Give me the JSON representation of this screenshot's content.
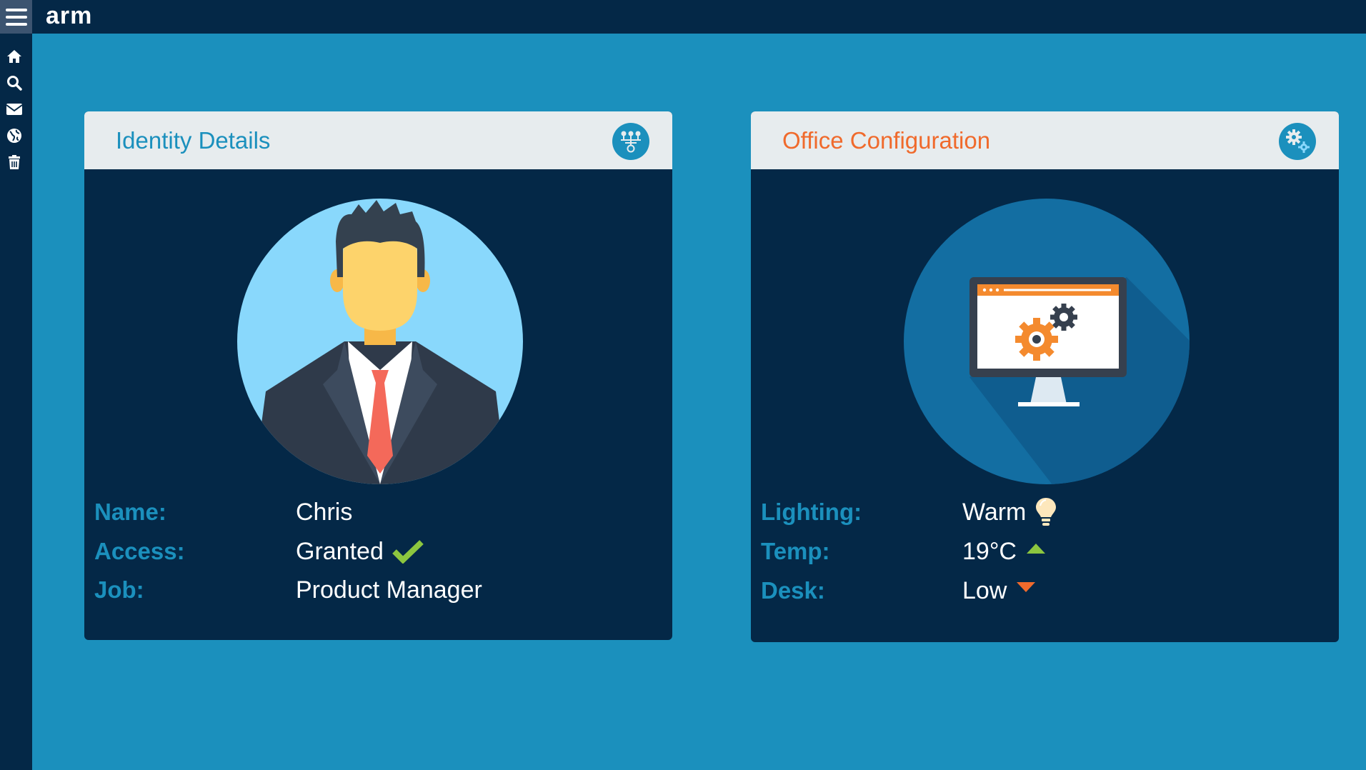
{
  "app": {
    "logo": "arm"
  },
  "sidebar": {
    "items": [
      {
        "icon": "home-icon"
      },
      {
        "icon": "search-icon"
      },
      {
        "icon": "mail-icon"
      },
      {
        "icon": "globe-icon"
      },
      {
        "icon": "trash-icon"
      }
    ]
  },
  "identity": {
    "title": "Identity Details",
    "header_icon": "network-icon",
    "fields": [
      {
        "label": "Name:",
        "value": "Chris"
      },
      {
        "label": "Access:",
        "value": "Granted",
        "icon": "check-icon"
      },
      {
        "label": "Job:",
        "value": "Product Manager"
      }
    ]
  },
  "office": {
    "title": "Office Configuration",
    "header_icon": "gears-icon",
    "fields": [
      {
        "label": "Lighting:",
        "value": "Warm",
        "icon": "lightbulb-icon"
      },
      {
        "label": "Temp:",
        "value": "19°C",
        "icon": "arrow-up-icon"
      },
      {
        "label": "Desk:",
        "value": "Low",
        "icon": "arrow-down-icon"
      }
    ]
  },
  "colors": {
    "background": "#1b90bd",
    "dark": "#042847",
    "header_bg": "#e7ecee",
    "accent_blue": "#1b90bd",
    "accent_orange": "#f06a2c",
    "check_green": "#8cc63f",
    "arrow_up_green": "#8cc63f",
    "arrow_down_orange": "#f06a2c"
  }
}
